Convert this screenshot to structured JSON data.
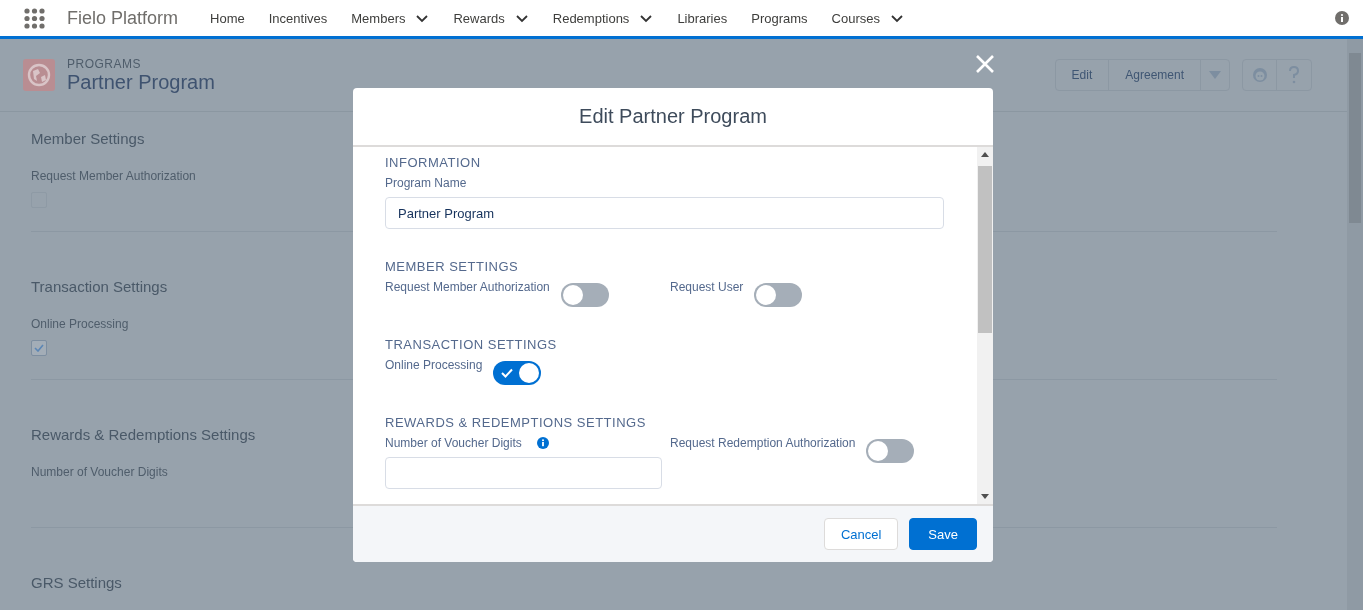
{
  "app": {
    "name": "Fielo Platform"
  },
  "nav": [
    {
      "label": "Home",
      "dropdown": false
    },
    {
      "label": "Incentives",
      "dropdown": false
    },
    {
      "label": "Members",
      "dropdown": true
    },
    {
      "label": "Rewards",
      "dropdown": true
    },
    {
      "label": "Redemptions",
      "dropdown": true
    },
    {
      "label": "Libraries",
      "dropdown": false
    },
    {
      "label": "Programs",
      "dropdown": false
    },
    {
      "label": "Courses",
      "dropdown": true
    }
  ],
  "record": {
    "object": "PROGRAMS",
    "title": "Partner Program",
    "actions": [
      {
        "kind": "text",
        "label": "Edit"
      },
      {
        "kind": "text",
        "label": "Agreement"
      },
      {
        "kind": "menu"
      }
    ]
  },
  "sections": [
    {
      "title": "Member Settings",
      "field": {
        "kind": "checkbox",
        "label": "Request Member Authorization",
        "checked": false
      }
    },
    {
      "title": "Transaction Settings",
      "field": {
        "kind": "checkbox",
        "label": "Online Processing",
        "checked": true
      }
    },
    {
      "title": "Rewards & Redemptions Settings",
      "field": {
        "kind": "empty",
        "label": "Number of Voucher Digits"
      }
    },
    {
      "title": "GRS Settings"
    }
  ],
  "modal": {
    "title": "Edit Partner Program",
    "sections": [
      {
        "heading": "INFORMATION",
        "fields": [
          {
            "kind": "text",
            "label": "Program Name",
            "value": "Partner Program"
          }
        ]
      },
      {
        "heading": "MEMBER SETTINGS",
        "fields": [
          {
            "kind": "toggle",
            "label": "Request Member Authorization",
            "on": false
          },
          {
            "kind": "toggle",
            "label": "Request User",
            "on": false
          }
        ]
      },
      {
        "heading": "TRANSACTION SETTINGS",
        "fields": [
          {
            "kind": "toggle",
            "label": "Online Processing",
            "on": true
          }
        ]
      },
      {
        "heading": "REWARDS & REDEMPTIONS SETTINGS",
        "fields": [
          {
            "kind": "text",
            "label": "Number of Voucher Digits",
            "info": true
          },
          {
            "kind": "toggle",
            "label": "Request Redemption Authorization",
            "on": false
          }
        ]
      }
    ],
    "buttons": [
      {
        "kind": "neutral",
        "label": "Cancel"
      },
      {
        "kind": "brand",
        "label": "Save"
      }
    ]
  }
}
